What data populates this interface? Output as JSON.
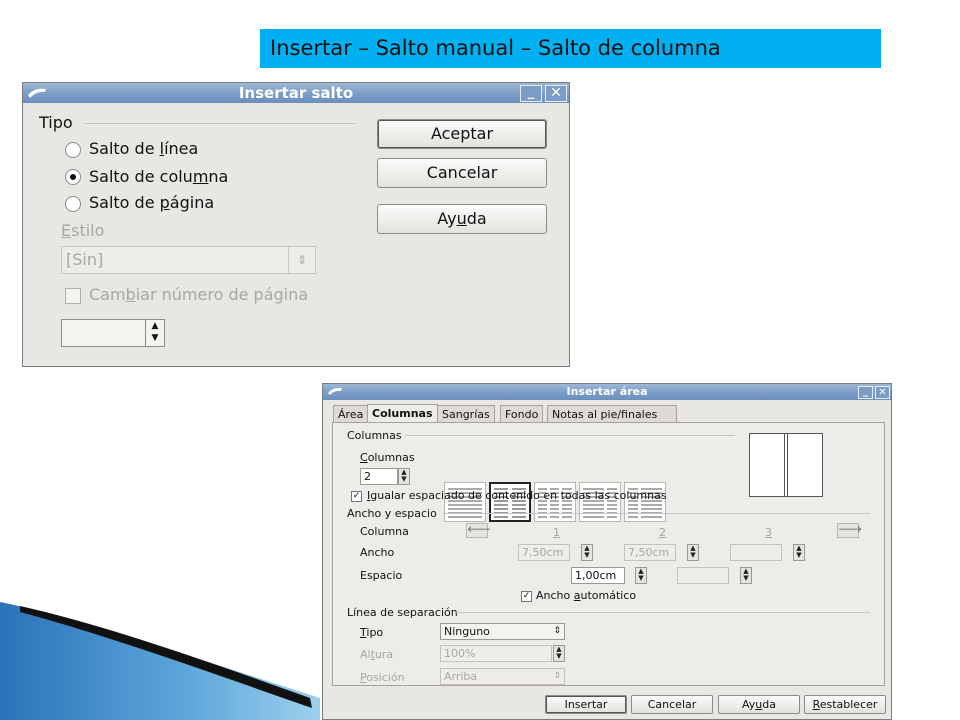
{
  "slide": {
    "title": "Insertar – Salto manual – Salto de columna"
  },
  "dialog1": {
    "title": "Insertar salto",
    "type_group": "Tipo",
    "options": [
      {
        "label": "Salto de línea",
        "selected": false
      },
      {
        "label": "Salto de columna",
        "selected": true
      },
      {
        "label": "Salto de página",
        "selected": false
      }
    ],
    "style_label": "Estilo",
    "style_value": "[Sin]",
    "change_page_number_label": "Cambiar número de página",
    "buttons": {
      "ok": "Aceptar",
      "cancel": "Cancelar",
      "help": "Ayuda"
    }
  },
  "dialog2": {
    "title": "Insertar área",
    "tabs": [
      {
        "label": "Área",
        "active": false
      },
      {
        "label": "Columnas",
        "active": true
      },
      {
        "label": "Sangrías",
        "active": false
      },
      {
        "label": "Fondo",
        "active": false
      },
      {
        "label": "Notas al pie/finales",
        "active": false
      }
    ],
    "columns_group": "Columnas",
    "columns_label": "Columnas",
    "columns_value": "2",
    "equalize_label": "Igualar espaciado de contenido en todas las columnas",
    "equalize_checked": true,
    "width_group": "Ancho y espacio",
    "column_row_label": "Columna",
    "column_numbers": [
      "1",
      "2",
      "3"
    ],
    "width_label": "Ancho",
    "width_values": [
      "7,50cm",
      "7,50cm",
      ""
    ],
    "spacing_label": "Espacio",
    "spacing_values": [
      "1,00cm",
      ""
    ],
    "auto_width_label": "Ancho automático",
    "auto_width_checked": true,
    "separator_group": "Línea de separación",
    "sep_type_label": "Tipo",
    "sep_type_value": "Ninguno",
    "sep_height_label": "Altura",
    "sep_height_value": "100%",
    "sep_position_label": "Posición",
    "sep_position_value": "Arriba",
    "buttons": {
      "insert": "Insertar",
      "cancel": "Cancelar",
      "help": "Ayuda",
      "reset": "Restablecer"
    }
  },
  "colors": {
    "title_band": "#00b0f0",
    "titlebar": "#7a9cc6",
    "dialog_bg": "#e9e7e3"
  }
}
